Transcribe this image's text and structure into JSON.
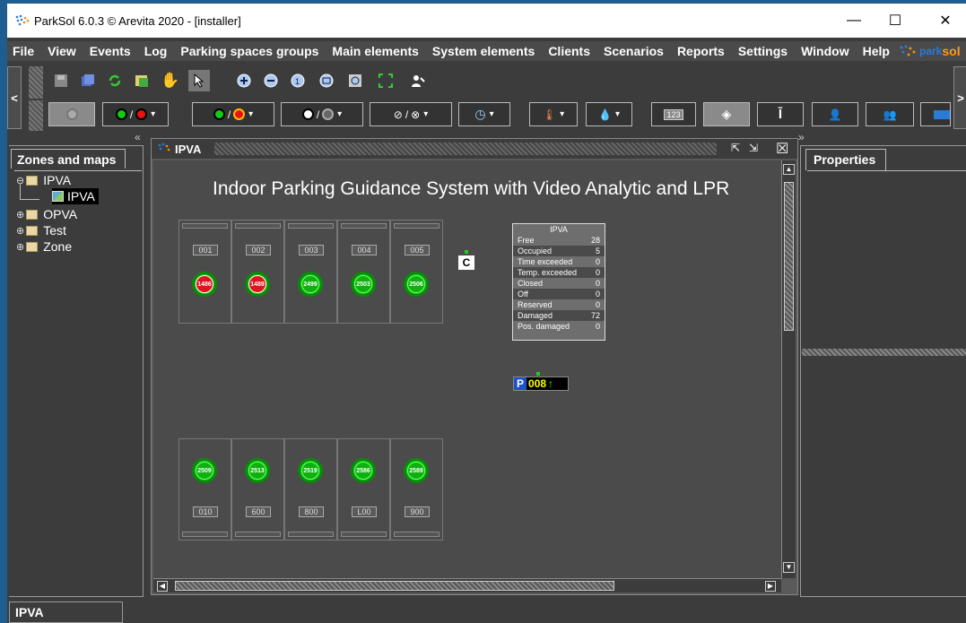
{
  "window": {
    "title": "ParkSol 6.0.3 © Arevita 2020 - [installer]",
    "min": "—",
    "max": "☐",
    "close": "✕"
  },
  "menu": [
    "File",
    "View",
    "Events",
    "Log",
    "Parking spaces groups",
    "Main elements",
    "System elements",
    "Clients",
    "Scenarios",
    "Reports",
    "Settings",
    "Window",
    "Help"
  ],
  "logo": {
    "text": "parksol",
    "partial": "sol"
  },
  "nav": {
    "left": "<",
    "right": ">"
  },
  "collapse": {
    "left": "«",
    "right": "»"
  },
  "toolbar2": {
    "sep": "/",
    "caret": "▾",
    "display_label": "123"
  },
  "zones": {
    "tab": "Zones and maps",
    "items": [
      {
        "label": "IPVA",
        "expanded": true,
        "child": "IPVA"
      },
      {
        "label": "OPVA"
      },
      {
        "label": "Test"
      },
      {
        "label": "Zone"
      }
    ]
  },
  "frame": {
    "title": "IPVA",
    "heading": "Indoor Parking Guidance System with Video Analytic and LPR",
    "close": "☒"
  },
  "slots_top": [
    {
      "label": "001",
      "sensor": "1486",
      "state": "red"
    },
    {
      "label": "002",
      "sensor": "1489",
      "state": "red"
    },
    {
      "label": "003",
      "sensor": "2499",
      "state": "green"
    },
    {
      "label": "004",
      "sensor": "2503",
      "state": "green"
    },
    {
      "label": "005",
      "sensor": "2506",
      "state": "green"
    }
  ],
  "slots_bottom": [
    {
      "label": "010",
      "sensor": "2509",
      "state": "green"
    },
    {
      "label": "600",
      "sensor": "2513",
      "state": "green"
    },
    {
      "label": "800",
      "sensor": "2519",
      "state": "green"
    },
    {
      "label": "L00",
      "sensor": "2586",
      "state": "green"
    },
    {
      "label": "900",
      "sensor": "2589",
      "state": "green"
    }
  ],
  "stats": {
    "title": "IPVA",
    "rows": [
      {
        "k": "Free",
        "v": "28"
      },
      {
        "k": "Occupied",
        "v": "5"
      },
      {
        "k": "Time exceeded",
        "v": "0"
      },
      {
        "k": "Temp. exceeded",
        "v": "0"
      },
      {
        "k": "Closed",
        "v": "0"
      },
      {
        "k": "Off",
        "v": "0"
      },
      {
        "k": "Reserved",
        "v": "0"
      },
      {
        "k": "Damaged",
        "v": "72"
      },
      {
        "k": "Pos. damaged",
        "v": "0"
      }
    ]
  },
  "cicon": "C",
  "pdisplay": {
    "p": "P",
    "num": "008",
    "arrow": "↑"
  },
  "properties": {
    "tab": "Properties"
  },
  "status": {
    "label": "IPVA"
  },
  "colors": {
    "menubg": "#4a4a4a",
    "accent": "#ff9a1a",
    "green": "#14c814",
    "red": "#e0141e"
  }
}
